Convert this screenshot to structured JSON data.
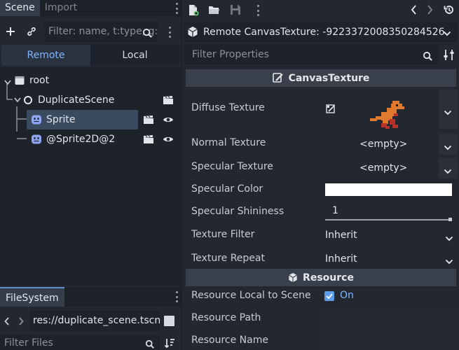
{
  "left_dock": {
    "tabs": [
      {
        "label": "Scene"
      },
      {
        "label": "Import"
      }
    ],
    "scene_filter_placeholder": "Filter: name, t:type, g:group",
    "remote_tab": "Remote",
    "local_tab": "Local",
    "tree": [
      {
        "label": "root",
        "depth": 0,
        "selected": false
      },
      {
        "label": "DuplicateScene",
        "depth": 1,
        "selected": false
      },
      {
        "label": "Sprite",
        "depth": 2,
        "selected": true
      },
      {
        "label": "@Sprite2D@2",
        "depth": 2,
        "selected": false
      }
    ]
  },
  "filesystem": {
    "tab": "FileSystem",
    "path": "res://duplicate_scene.tscn",
    "filter_placeholder": "Filter Files"
  },
  "inspector": {
    "resource_title": "Remote CanvasTexture: -9223372008350284526",
    "filter_placeholder": "Filter Properties",
    "section_canvas": "CanvasTexture",
    "section_resource": "Resource",
    "properties": {
      "diffuse_texture": "Diffuse Texture",
      "normal_texture": "Normal Texture",
      "normal_value": "<empty>",
      "specular_texture": "Specular Texture",
      "specular_value": "<empty>",
      "specular_color": "Specular Color",
      "specular_color_value": "#ffffff",
      "specular_shininess": "Specular Shininess",
      "specular_shininess_value": "1",
      "texture_filter": "Texture Filter",
      "texture_filter_value": "Inherit",
      "texture_repeat": "Texture Repeat",
      "texture_repeat_value": "Inherit",
      "resource_local": "Resource Local to Scene",
      "resource_local_value": "On",
      "resource_path": "Resource Path",
      "resource_name": "Resource Name"
    }
  },
  "colors": {
    "accent": "#7fb6ff",
    "selection": "#3a4a5f",
    "checkbox": "#5c9ce6",
    "dino_orange": "#e07a2e",
    "dino_red": "#b8322a"
  }
}
